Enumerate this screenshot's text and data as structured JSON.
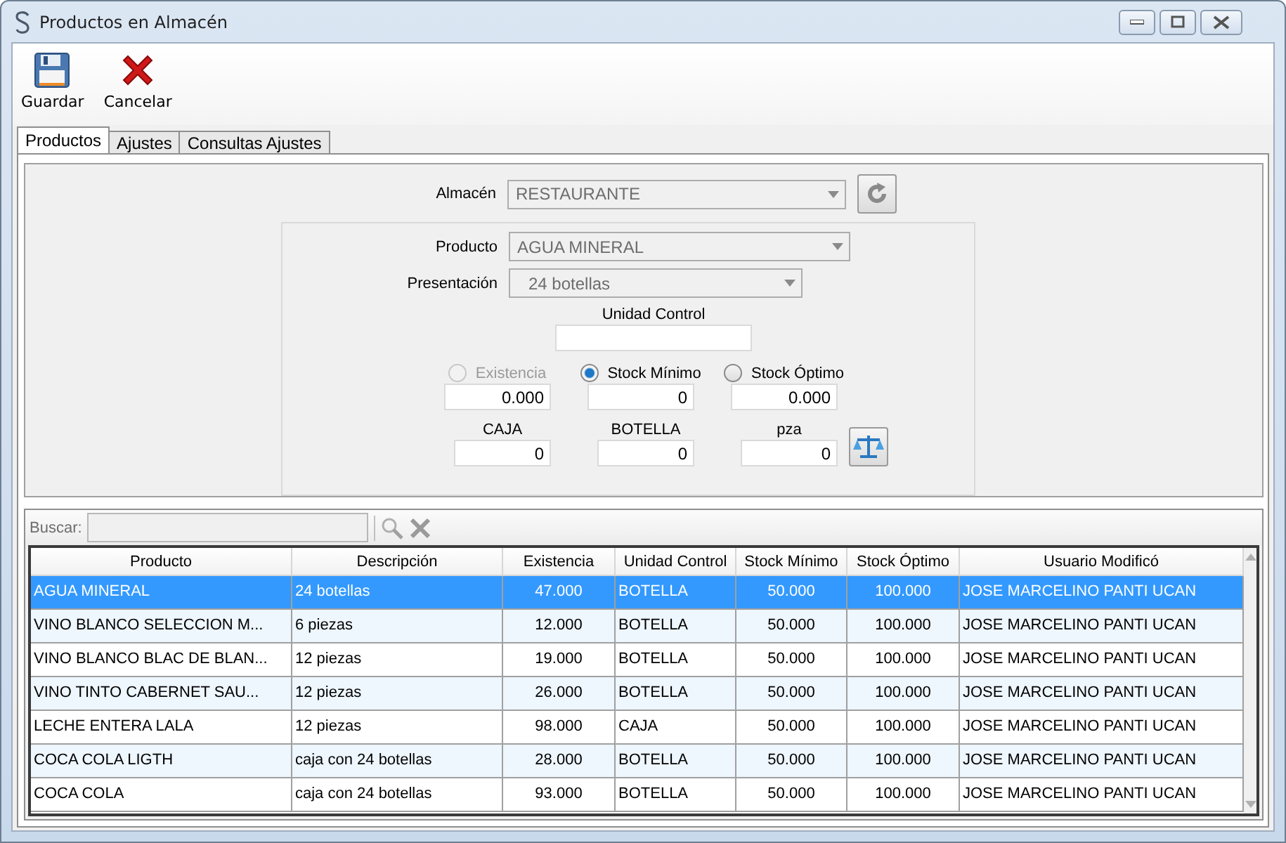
{
  "window": {
    "title": "Productos en Almacén"
  },
  "toolbar": [
    {
      "label": "Guardar",
      "kind": "save"
    },
    {
      "label": "Cancelar",
      "kind": "cancel"
    }
  ],
  "tabs": [
    {
      "label": "Productos",
      "selected": true
    },
    {
      "label": "Ajustes",
      "selected": false
    },
    {
      "label": "Consultas Ajustes",
      "selected": false
    }
  ],
  "form": {
    "almacen": {
      "label": "Almacén",
      "value": "RESTAURANTE"
    },
    "producto": {
      "label": "Producto",
      "value": "AGUA MINERAL"
    },
    "presentacion": {
      "label": "Presentación",
      "value": "24 botellas"
    },
    "unidad_control_label": "Unidad Control",
    "stock_options": [
      {
        "label": "Existencia",
        "selected": false,
        "disabled": true,
        "value": "0.000"
      },
      {
        "label": "Stock Mínimo",
        "selected": true,
        "disabled": false,
        "value": "0"
      },
      {
        "label": "Stock Óptimo",
        "selected": false,
        "disabled": false,
        "value": "0.000"
      }
    ],
    "units": [
      {
        "label": "CAJA",
        "value": "0"
      },
      {
        "label": "BOTELLA",
        "value": "0"
      },
      {
        "label": "pza",
        "value": "0"
      }
    ]
  },
  "grid": {
    "search_label": "Buscar:",
    "columns": [
      "Producto",
      "Descripción",
      "Existencia",
      "Unidad Control",
      "Stock Mínimo",
      "Stock Óptimo",
      "Usuario Modificó"
    ],
    "rows": [
      {
        "selected": true,
        "cells": [
          "AGUA MINERAL",
          "24 botellas",
          "47.000",
          "BOTELLA",
          "50.000",
          "100.000",
          "JOSE MARCELINO PANTI UCAN"
        ]
      },
      {
        "selected": false,
        "cells": [
          "VINO BLANCO SELECCION M...",
          "6 piezas",
          "12.000",
          "BOTELLA",
          "50.000",
          "100.000",
          "JOSE MARCELINO PANTI UCAN"
        ]
      },
      {
        "selected": false,
        "cells": [
          "VINO BLANCO BLAC DE BLAN...",
          "12 piezas",
          "19.000",
          "BOTELLA",
          "50.000",
          "100.000",
          "JOSE MARCELINO PANTI UCAN"
        ]
      },
      {
        "selected": false,
        "cells": [
          "VINO TINTO CABERNET SAU...",
          "12 piezas",
          "26.000",
          "BOTELLA",
          "50.000",
          "100.000",
          "JOSE MARCELINO PANTI UCAN"
        ]
      },
      {
        "selected": false,
        "cells": [
          "LECHE ENTERA LALA",
          "12 piezas",
          "98.000",
          "CAJA",
          "50.000",
          "100.000",
          "JOSE MARCELINO PANTI UCAN"
        ]
      },
      {
        "selected": false,
        "cells": [
          "COCA COLA LIGTH",
          "caja con 24 botellas",
          "28.000",
          "BOTELLA",
          "50.000",
          "100.000",
          "JOSE MARCELINO PANTI UCAN"
        ]
      },
      {
        "selected": false,
        "cells": [
          "COCA COLA",
          "caja con 24 botellas",
          "93.000",
          "BOTELLA",
          "50.000",
          "100.000",
          "JOSE MARCELINO PANTI UCAN"
        ]
      }
    ]
  }
}
